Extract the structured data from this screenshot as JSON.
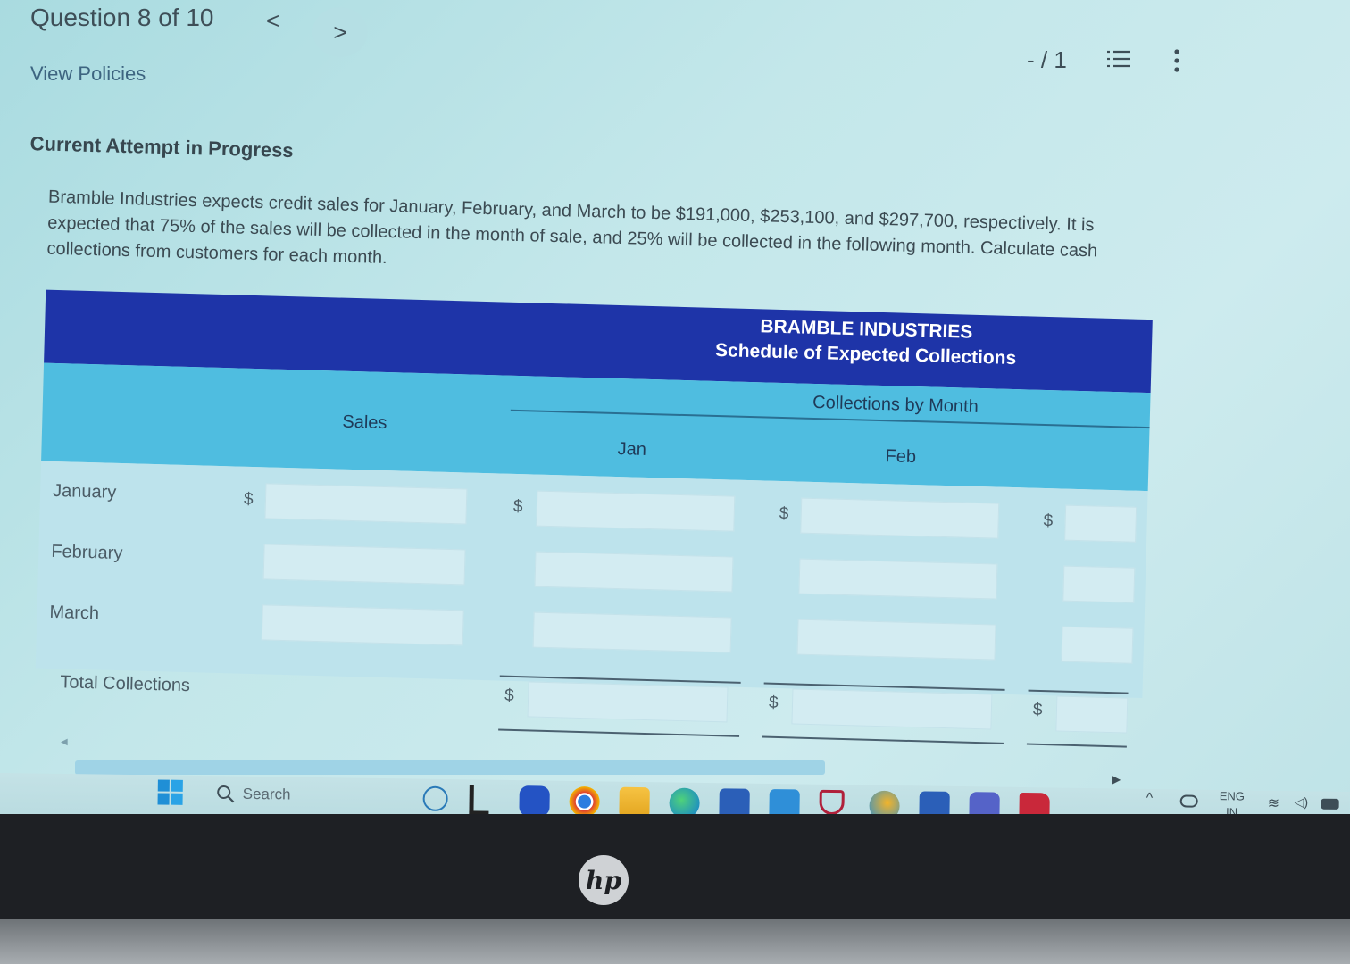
{
  "header": {
    "question_label": "Question 8 of 10",
    "prev_glyph": "<",
    "next_glyph": ">",
    "view_policies": "View Policies",
    "score": "- / 1"
  },
  "attempt": {
    "title": "Current Attempt in Progress",
    "problem_text": "Bramble Industries expects credit sales for January, February, and March to be $191,000, $253,100, and $297,700, respectively. It is expected that 75% of the sales will be collected in the month of sale, and 25% will be collected in the following month. Calculate cash collections from customers for each month."
  },
  "table": {
    "company": "BRAMBLE INDUSTRIES",
    "schedule_title": "Schedule of Expected Collections",
    "group_header": "Collections by Month",
    "col_sales": "Sales",
    "col_jan": "Jan",
    "col_feb": "Feb",
    "currency": "$",
    "rows": [
      {
        "label": "January",
        "sales": "",
        "jan": "",
        "feb": "",
        "mar": ""
      },
      {
        "label": "February",
        "sales": "",
        "jan": "",
        "feb": "",
        "mar": ""
      },
      {
        "label": "March",
        "sales": "",
        "jan": "",
        "feb": "",
        "mar": ""
      }
    ],
    "total_label": "Total Collections"
  },
  "taskbar": {
    "search_label": "Search",
    "lang_top": "ENG",
    "lang_bottom": "IN"
  },
  "device": {
    "brand": "hp"
  },
  "colors": {
    "header_blue": "#1e34a8",
    "subheader_cyan": "#4fbde0",
    "row_bg": "#bde3ec"
  }
}
